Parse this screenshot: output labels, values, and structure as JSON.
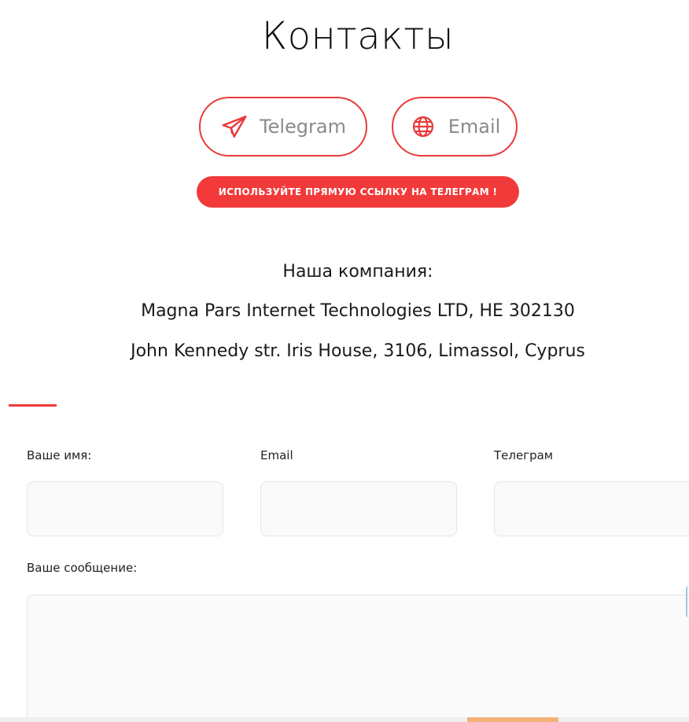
{
  "page": {
    "title": "Контакты"
  },
  "contacts": {
    "telegram": {
      "label": "Telegram",
      "icon": "paper-plane-icon"
    },
    "email": {
      "label": "Email",
      "icon": "globe-icon"
    },
    "notice": "ИСПОЛЬЗУЙТЕ ПРЯМУЮ ССЫЛКУ НА ТЕЛЕГРАМ !"
  },
  "company": {
    "heading": "Наша компания:",
    "name": "Magna Pars Internet Technologies LTD, HE 302130",
    "address": "John Kennedy str. Iris House, 3106, Limassol, Cyprus"
  },
  "form": {
    "name_label": "Ваше имя:",
    "name_value": "",
    "email_label": "Email",
    "email_value": "",
    "telegram_label": "Телеграм",
    "telegram_value": "",
    "message_label": "Ваше сообщение:",
    "message_value": ""
  },
  "colors": {
    "accent": "#e83a3a",
    "notice_bg": "#f23a3a",
    "field_bg": "#fafafa",
    "field_border": "#e6e6e6",
    "muted_text": "#8a8a8a"
  }
}
